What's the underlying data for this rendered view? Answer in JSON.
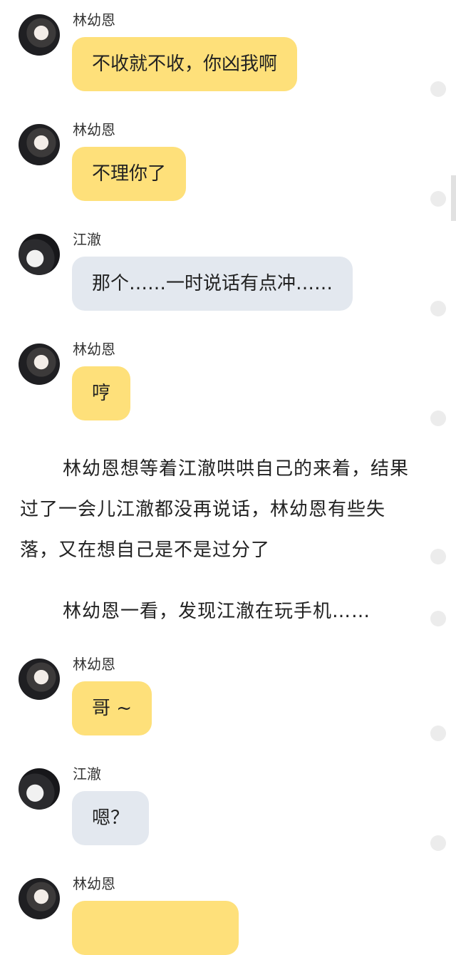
{
  "messages": [
    {
      "sender": "林幼恩",
      "text": "不收就不收，你凶我啊",
      "side": "yellow"
    },
    {
      "sender": "林幼恩",
      "text": "不理你了",
      "side": "yellow"
    },
    {
      "sender": "江澈",
      "text": "那个……一时说话有点冲……",
      "side": "gray"
    },
    {
      "sender": "林幼恩",
      "text": "哼",
      "side": "yellow"
    },
    {
      "sender": "林幼恩",
      "text": "哥 ~",
      "side": "yellow"
    },
    {
      "sender": "江澈",
      "text": "嗯？",
      "side": "gray"
    },
    {
      "sender": "林幼恩",
      "text": "",
      "side": "yellow"
    }
  ],
  "narration": {
    "paragraph_1": "林幼恩想等着江澈哄哄自己的来着，结果过了一会儿江澈都没再说话，林幼恩有些失落，又在想自己是不是过分了",
    "paragraph_2": "林幼恩一看，发现江澈在玩手机……"
  },
  "colors": {
    "bubble_yellow": "#fee07a",
    "bubble_gray": "#e3e8ef"
  },
  "icons": [
    "avatar-lin-youen",
    "avatar-jiang-che",
    "comment-dot"
  ]
}
